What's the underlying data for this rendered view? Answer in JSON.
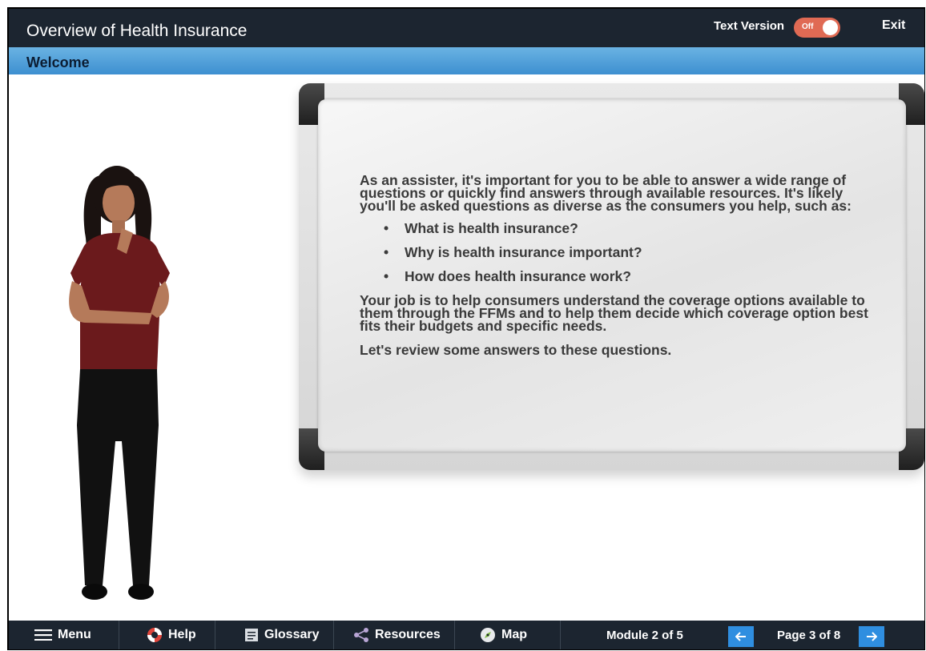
{
  "header": {
    "title": "Overview of Health Insurance",
    "text_version_label": "Text Version",
    "toggle_state": "Off",
    "exit_label": "Exit"
  },
  "section": {
    "title": "Welcome"
  },
  "whiteboard": {
    "intro": "As an assister, it's important for you to be able to answer a wide range of questions or quickly find answers through available resources. It's likely you'll be asked questions as diverse as the consumers you help, such as:",
    "bullets": [
      "What is health insurance?",
      "Why is health insurance important?",
      "How does health insurance work?"
    ],
    "paragraph2": "Your job is to help consumers understand the coverage options available to them through the FFMs and to help them decide which coverage option best fits their budgets and specific needs.",
    "paragraph3": "Let's review some answers to these questions."
  },
  "footer": {
    "menu_label": "Menu",
    "help_label": "Help",
    "glossary_label": "Glossary",
    "resources_label": "Resources",
    "map_label": "Map",
    "module_label": "Module 2 of 5",
    "page_label": "Page 3 of 8"
  },
  "icons": {
    "menu": "hamburger-icon",
    "help": "lifebuoy-icon",
    "glossary": "book-icon",
    "resources": "share-icon",
    "map": "compass-icon",
    "prev": "arrow-left-icon",
    "next": "arrow-right-icon"
  },
  "colors": {
    "header_bg": "#1c2530",
    "section_bar": "#4a9ad6",
    "toggle": "#e06a54",
    "nav_arrow": "#2f8ee0"
  }
}
